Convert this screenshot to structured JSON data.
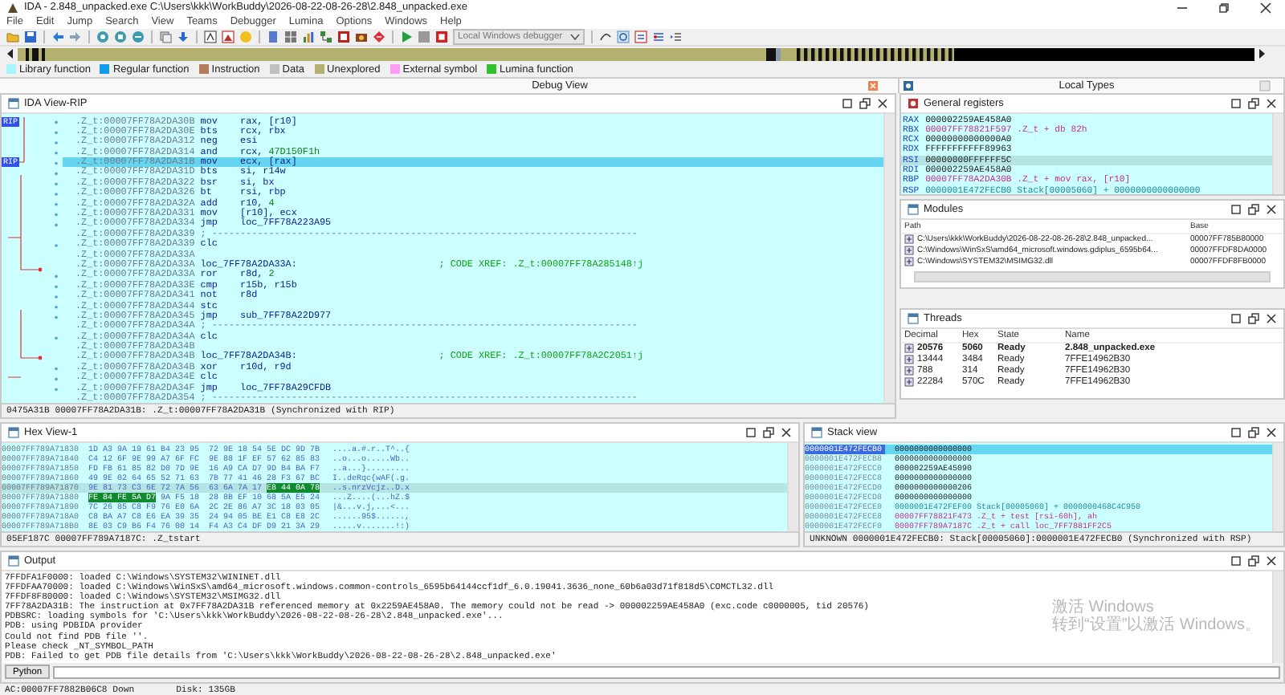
{
  "window": {
    "title": "IDA - 2.848_unpacked.exe C:\\Users\\kkk\\WorkBuddy\\2026-08-22-08-26-28\\2.848_unpacked.exe"
  },
  "menu": [
    "File",
    "Edit",
    "Jump",
    "Search",
    "View",
    "Teams",
    "Debugger",
    "Lumina",
    "Options",
    "Windows",
    "Help"
  ],
  "toolbar": {
    "debugger_select": "Local Windows debugger"
  },
  "legend": [
    {
      "label": "Library function",
      "color": "#a8f4fc"
    },
    {
      "label": "Regular function",
      "color": "#109ce8"
    },
    {
      "label": "Instruction",
      "color": "#b47c5c"
    },
    {
      "label": "Data",
      "color": "#c0c0c0"
    },
    {
      "label": "Unexplored",
      "color": "#b4b070"
    },
    {
      "label": "External symbol",
      "color": "#fc9cf4"
    },
    {
      "label": "Lumina function",
      "color": "#30c030"
    }
  ],
  "docks": [
    {
      "title": "Debug View"
    },
    {
      "title": "Local Types"
    }
  ],
  "ida_view": {
    "title": "IDA View-RIP",
    "lines": [
      {
        "kind": "ins",
        "marker": "RIP",
        "selected": false,
        "addr": ".Z_t:00007FF78A2DA30B",
        "mnem": "mov",
        "ops": "rax, [r10]"
      },
      {
        "kind": "ins",
        "selected": false,
        "addr": ".Z_t:00007FF78A2DA30E",
        "mnem": "bts",
        "ops": "rcx, rbx"
      },
      {
        "kind": "ins",
        "selected": false,
        "addr": ".Z_t:00007FF78A2DA312",
        "mnem": "neg",
        "ops": "esi"
      },
      {
        "kind": "ins",
        "selected": false,
        "addr": ".Z_t:00007FF78A2DA314",
        "mnem": "and",
        "ops": "rcx, ",
        "num": "47D150F1h"
      },
      {
        "kind": "ins",
        "marker": "RIP",
        "selected": true,
        "addr": ".Z_t:00007FF78A2DA31B",
        "mnem": "mov",
        "ops": "ecx, [rax]"
      },
      {
        "kind": "ins",
        "selected": false,
        "addr": ".Z_t:00007FF78A2DA31D",
        "mnem": "bts",
        "ops": "si, r14w"
      },
      {
        "kind": "ins",
        "selected": false,
        "addr": ".Z_t:00007FF78A2DA322",
        "mnem": "bsr",
        "ops": "si, bx"
      },
      {
        "kind": "ins",
        "selected": false,
        "addr": ".Z_t:00007FF78A2DA326",
        "mnem": "bt",
        "ops": "rsi, rbp"
      },
      {
        "kind": "ins",
        "selected": false,
        "addr": ".Z_t:00007FF78A2DA32A",
        "mnem": "add",
        "ops": "r10, ",
        "num": "4"
      },
      {
        "kind": "ins",
        "selected": false,
        "addr": ".Z_t:00007FF78A2DA331",
        "mnem": "mov",
        "ops": "[r10], ecx"
      },
      {
        "kind": "ins",
        "selected": false,
        "addr": ".Z_t:00007FF78A2DA334",
        "mnem": "jmp",
        "ops": "loc_7FF78A223A95"
      },
      {
        "kind": "sep",
        "selected": false,
        "addr": ".Z_t:00007FF78A2DA339",
        "text": "; ---------------------------------------------------------------------------"
      },
      {
        "kind": "ins",
        "selected": false,
        "addr": ".Z_t:00007FF78A2DA339",
        "mnem": "clc"
      },
      {
        "kind": "blank",
        "selected": false,
        "addr": ".Z_t:00007FF78A2DA33A"
      },
      {
        "kind": "label",
        "selected": false,
        "addr": ".Z_t:00007FF78A2DA33A",
        "text": "loc_7FF78A2DA33A:",
        "comment": "; CODE XREF: .Z_t:00007FF78A285148↑j"
      },
      {
        "kind": "ins",
        "selected": false,
        "addr": ".Z_t:00007FF78A2DA33A",
        "mnem": "ror",
        "ops": "r8d, ",
        "num": "2"
      },
      {
        "kind": "ins",
        "selected": false,
        "addr": ".Z_t:00007FF78A2DA33E",
        "mnem": "cmp",
        "ops": "r15b, r15b"
      },
      {
        "kind": "ins",
        "selected": false,
        "addr": ".Z_t:00007FF78A2DA341",
        "mnem": "not",
        "ops": "r8d"
      },
      {
        "kind": "ins",
        "selected": false,
        "addr": ".Z_t:00007FF78A2DA344",
        "mnem": "stc"
      },
      {
        "kind": "ins",
        "selected": false,
        "addr": ".Z_t:00007FF78A2DA345",
        "mnem": "jmp",
        "ops": "sub_7FF78A22D977"
      },
      {
        "kind": "sep",
        "selected": false,
        "addr": ".Z_t:00007FF78A2DA34A",
        "text": "; ---------------------------------------------------------------------------"
      },
      {
        "kind": "ins",
        "selected": false,
        "addr": ".Z_t:00007FF78A2DA34A",
        "mnem": "clc"
      },
      {
        "kind": "blank",
        "selected": false,
        "addr": ".Z_t:00007FF78A2DA34B"
      },
      {
        "kind": "label",
        "selected": false,
        "addr": ".Z_t:00007FF78A2DA34B",
        "text": "loc_7FF78A2DA34B:",
        "comment": "; CODE XREF: .Z_t:00007FF78A2C2051↑j"
      },
      {
        "kind": "ins",
        "selected": false,
        "addr": ".Z_t:00007FF78A2DA34B",
        "mnem": "xor",
        "ops": "r10d, r9d"
      },
      {
        "kind": "ins",
        "selected": false,
        "addr": ".Z_t:00007FF78A2DA34E",
        "mnem": "clc"
      },
      {
        "kind": "ins",
        "selected": false,
        "addr": ".Z_t:00007FF78A2DA34F",
        "mnem": "jmp",
        "ops": "loc_7FF78A29CFDB"
      },
      {
        "kind": "sep",
        "selected": false,
        "addr": ".Z_t:00007FF78A2DA354",
        "text": "; ---------------------------------------------------------------------------"
      }
    ],
    "status": "0475A31B 00007FF78A2DA31B: .Z_t:00007FF78A2DA31B (Synchronized with RIP)"
  },
  "registers": {
    "title": "General registers",
    "rows": [
      {
        "name": "RAX",
        "value": "000002259AE458A0",
        "kind": "plain",
        "selected": false
      },
      {
        "name": "RBX",
        "value": "00007FF78821F597 .Z_t + db 82h",
        "kind": "code",
        "selected": false
      },
      {
        "name": "RCX",
        "value": "00000000000000A0",
        "kind": "plain",
        "selected": false
      },
      {
        "name": "RDX",
        "value": "FFFFFFFFFFF89963",
        "kind": "plain",
        "selected": false
      },
      {
        "name": "RSI",
        "value": "00000000FFFFFF5C",
        "kind": "plain",
        "selected": true
      },
      {
        "name": "RDI",
        "value": "000002259AE458A0",
        "kind": "plain",
        "selected": false
      },
      {
        "name": "RBP",
        "value": "00007FF78A2DA30B .Z_t + mov rax, [r10]",
        "kind": "code",
        "selected": false
      },
      {
        "name": "RSP",
        "value": "0000001E472FECB0 Stack[00005060] + 0000000000000000",
        "kind": "stack",
        "selected": false
      }
    ]
  },
  "modules": {
    "title": "Modules",
    "columns": [
      "Path",
      "Base"
    ],
    "rows": [
      {
        "path": "C:\\Users\\kkk\\WorkBuddy\\2026-08-22-08-26-28\\2.848_unpacked...",
        "base": "00007FF785B80000"
      },
      {
        "path": "C:\\Windows\\WinSxS\\amd64_microsoft.windows.gdiplus_6595b64...",
        "base": "00007FFDF8DA0000"
      },
      {
        "path": "C:\\Windows\\SYSTEM32\\MSIMG32.dll",
        "base": "00007FFDF8FB0000"
      }
    ]
  },
  "threads": {
    "title": "Threads",
    "columns": [
      "Decimal",
      "Hex",
      "State",
      "Name"
    ],
    "rows": [
      {
        "decimal": "20576",
        "hex": "5060",
        "state": "Ready",
        "name": "2.848_unpacked.exe",
        "current": true
      },
      {
        "decimal": "13444",
        "hex": "3484",
        "state": "Ready",
        "name": "7FFE14962B30",
        "current": false
      },
      {
        "decimal": "788",
        "hex": "314",
        "state": "Ready",
        "name": "7FFE14962B30",
        "current": false
      },
      {
        "decimal": "22284",
        "hex": "570C",
        "state": "Ready",
        "name": "7FFE14962B30",
        "current": false
      }
    ]
  },
  "hex_view": {
    "title": "Hex View-1",
    "rows": [
      {
        "addr": "00007FF789A71830",
        "selected": false,
        "segments": [
          {
            "text": "1D A3 9A 19 61 B4 23 95  72 9E 18 54 5E DC 9D 7B",
            "hl": false
          }
        ],
        "ascii": "....a.#.r..T^..{"
      },
      {
        "addr": "00007FF789A71840",
        "selected": false,
        "segments": [
          {
            "text": "C4 12 6F 9E 99 A7 6F FC  9E 88 1F EF 57 62 85 83",
            "hl": false
          }
        ],
        "ascii": "..o...o.....Wb.."
      },
      {
        "addr": "00007FF789A71850",
        "selected": false,
        "segments": [
          {
            "text": "FD FB 61 85 82 D0 7D 9E  16 A9 CA D7 9D B4 BA F7",
            "hl": false
          }
        ],
        "ascii": "..a...}........."
      },
      {
        "addr": "00007FF789A71860",
        "selected": false,
        "segments": [
          {
            "text": "49 9E 02 64 65 52 71 63  7B 77 41 46 28 F3 67 BC",
            "hl": false
          }
        ],
        "ascii": "I..deRqc{wAF(.g."
      },
      {
        "addr": "00007FF789A71870",
        "selected": true,
        "segments": [
          {
            "text": "9E 81 73 C3 6E 72 7A 56  63 6A 7A 17",
            "hl": false
          },
          {
            "text": "E8 44 0A 78",
            "hl": true
          }
        ],
        "ascii": "..s.nrzVcjz..D.x"
      },
      {
        "addr": "00007FF789A71880",
        "selected": false,
        "segments": [
          {
            "text": "FE 84 FE 5A D7",
            "hl": true
          },
          {
            "text": "9A F5 18  28 8B EF 10 68 5A E5 24",
            "hl": false
          }
        ],
        "ascii": "...Z....(...hZ.$"
      },
      {
        "addr": "00007FF789A71890",
        "selected": false,
        "segments": [
          {
            "text": "7C 26 85 C8 F9 76 E0 6A  2C 2E 86 A7 3C 18 03 05",
            "hl": false
          }
        ],
        "ascii": "|&...v.j,...<..."
      },
      {
        "addr": "00007FF789A718A0",
        "selected": false,
        "segments": [
          {
            "text": "C8 BA A7 C8 E6 EA 39 35  24 94 05 BE E1 C8 E8 2C",
            "hl": false
          }
        ],
        "ascii": "......95$......,"
      },
      {
        "addr": "00007FF789A718B0",
        "selected": false,
        "segments": [
          {
            "text": "8E 03 C9 B6 F4 76 00 14  F4 A3 C4 DF D9 21 3A 29",
            "hl": false
          }
        ],
        "ascii": ".....v.......!:)"
      }
    ],
    "status": "05EF187C 00007FF789A7187C: .Z_tstart"
  },
  "stack_view": {
    "title": "Stack view",
    "rows": [
      {
        "addr": "0000001E472FECB0",
        "value": "0000000000000000",
        "kind": "plain",
        "selected": true
      },
      {
        "addr": "0000001E472FECB8",
        "value": "0000000000000000",
        "kind": "plain",
        "selected": false
      },
      {
        "addr": "0000001E472FECC0",
        "value": "000002259AE45090",
        "kind": "plain",
        "selected": false
      },
      {
        "addr": "0000001E472FECC8",
        "value": "0000000000000000",
        "kind": "plain",
        "selected": false
      },
      {
        "addr": "0000001E472FECD0",
        "value": "0000000000000206",
        "kind": "plain",
        "selected": false
      },
      {
        "addr": "0000001E472FECD8",
        "value": "0000000000000000",
        "kind": "plain",
        "selected": false
      },
      {
        "addr": "0000001E472FECE0",
        "value": "0000001E472FEF00 Stack[00005060] + 0000000468C4C950",
        "kind": "stack",
        "selected": false
      },
      {
        "addr": "0000001E472FECE8",
        "value": "00007FF78821F473 .Z_t + test [rsi-60h], ah",
        "kind": "code",
        "selected": false
      },
      {
        "addr": "0000001E472FECF0",
        "value": "00007FF789A7187C .Z_t + call loc_7FF7881FF2C5",
        "kind": "code",
        "selected": false
      }
    ],
    "status": "UNKNOWN 0000001E472FECB0: Stack[00005060]:0000001E472FECB0 (Synchronized with RSP)"
  },
  "output": {
    "title": "Output",
    "lines": [
      "7FFDFA1F0000: loaded C:\\Windows\\SYSTEM32\\WININET.dll",
      "7FFDFAA70000: loaded C:\\Windows\\WinSxS\\amd64_microsoft.windows.common-controls_6595b64144ccf1df_6.0.19041.3636_none_60b6a03d71f818d5\\COMCTL32.dll",
      "7FFDF8F80000: loaded C:\\Windows\\SYSTEM32\\MSIMG32.dll",
      "7FF78A2DA31B: The instruction at 0x7FF78A2DA31B referenced memory at 0x2259AE458A0. The memory could not be read -> 000002259AE458A0 (exc.code c0000005, tid 20576)",
      "PDBSRC: loading symbols for 'C:\\Users\\kkk\\WorkBuddy\\2026-08-22-08-26-28\\2.848_unpacked.exe'...",
      "PDB: using PDBIDA provider",
      "Could not find PDB file ''.",
      "Please check _NT_SYMBOL_PATH",
      "PDB: Failed to get PDB file details from 'C:\\Users\\kkk\\WorkBuddy\\2026-08-22-08-26-28\\2.848_unpacked.exe'"
    ],
    "language_button": "Python"
  },
  "os_overlay": {
    "title": "激活 Windows",
    "hint": "转到“设置”以激活 Windows。"
  },
  "status_bar": {
    "address": "AC:00007FF7882B06C8 Down",
    "disk": "Disk: 135GB"
  }
}
